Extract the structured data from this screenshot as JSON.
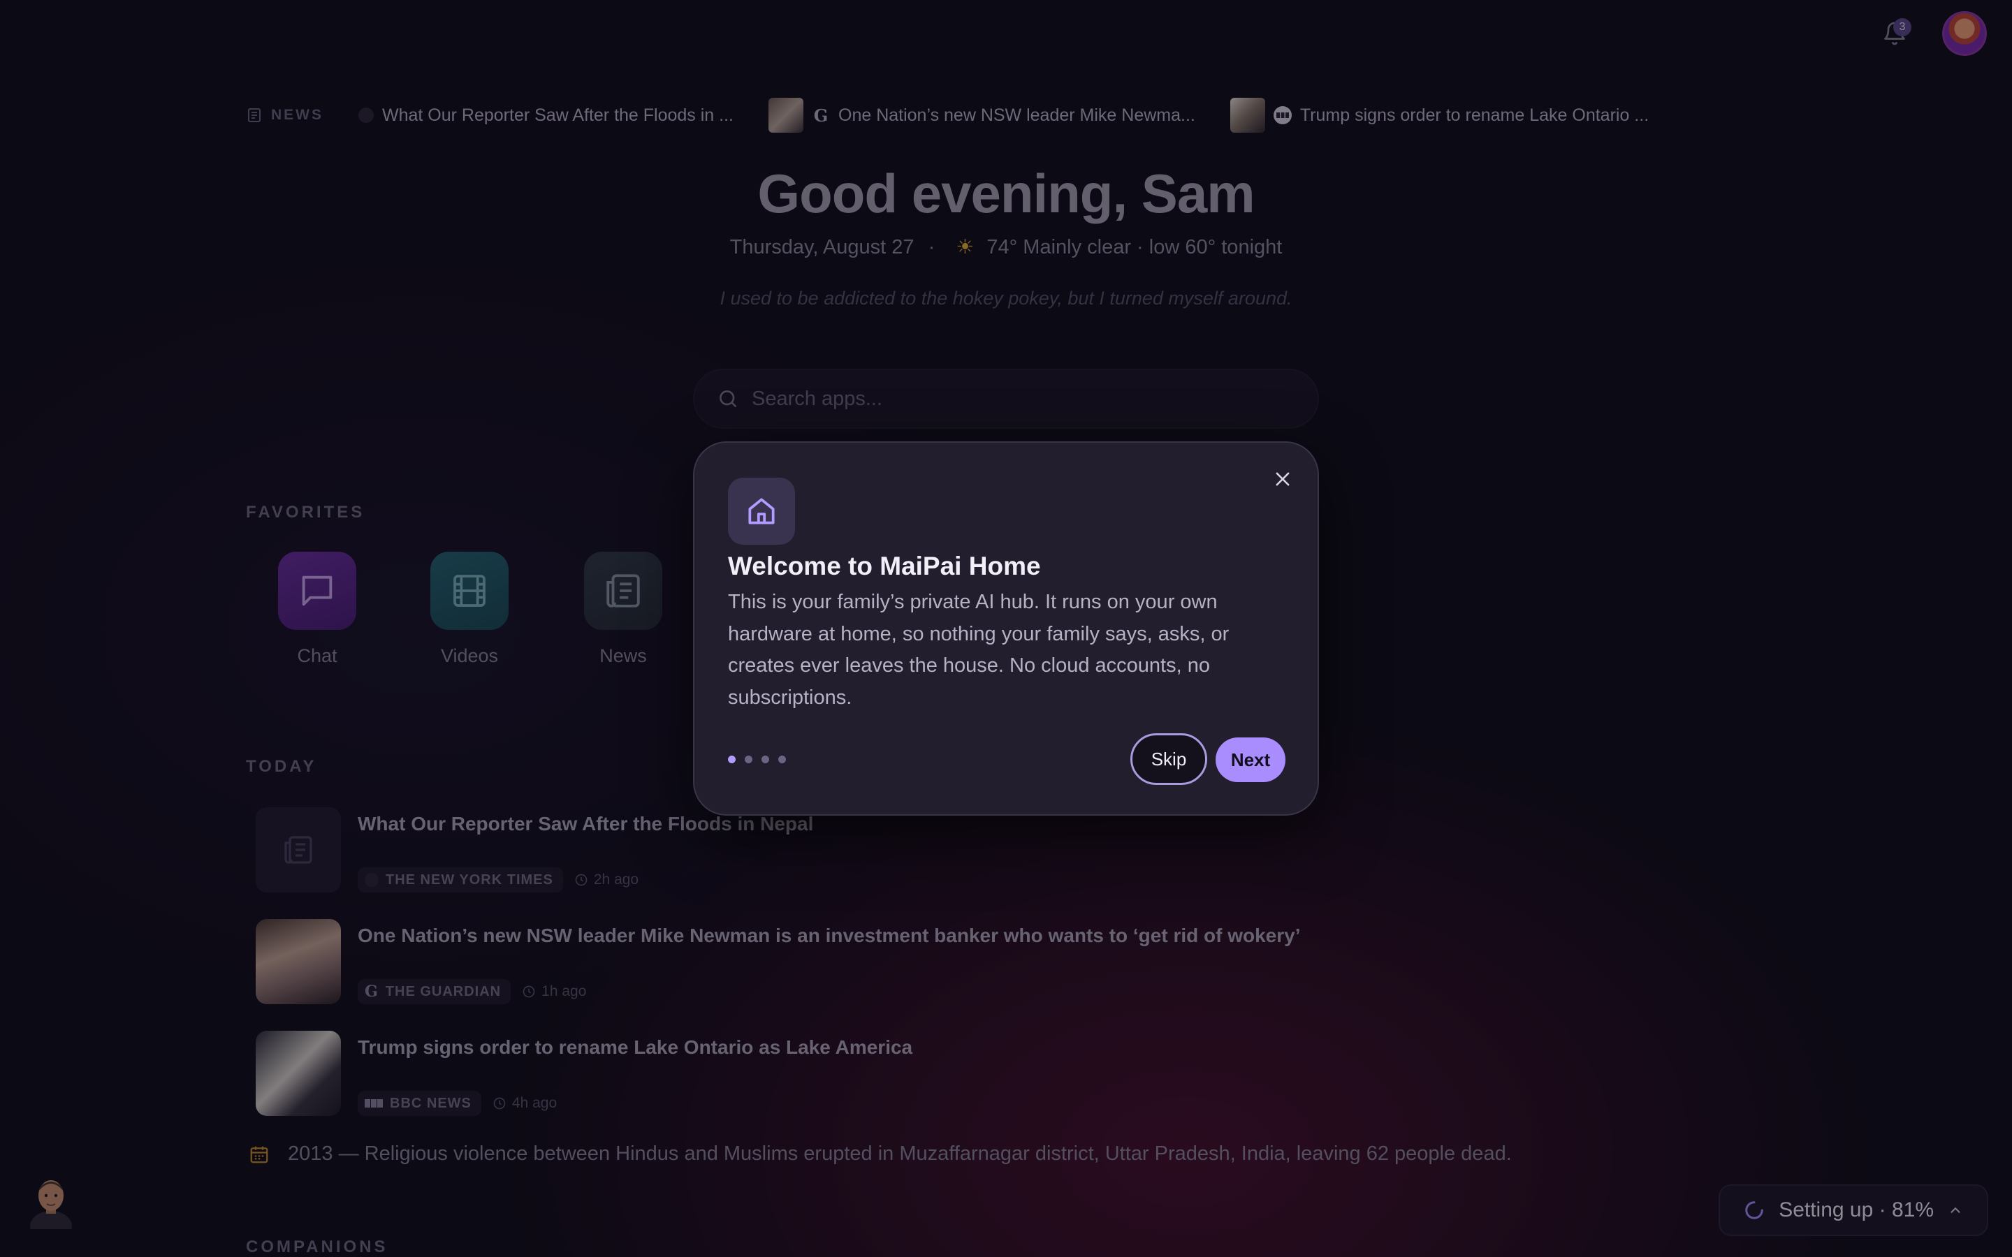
{
  "notifications": {
    "count": "3"
  },
  "news_ticker": {
    "label": "NEWS",
    "items": [
      {
        "title": "What Our Reporter Saw After the Floods in ..."
      },
      {
        "title": "One Nation’s new NSW leader Mike Newma...",
        "source_mark": "G"
      },
      {
        "title": "Trump signs order to rename Lake Ontario ..."
      }
    ]
  },
  "greeting": {
    "title": "Good evening, Sam",
    "date": "Thursday, August 27",
    "separator": "·",
    "weather": "74° Mainly clear · low 60° tonight",
    "quote": "I used to be addicted to the hokey pokey, but I turned myself around."
  },
  "search": {
    "placeholder": "Search apps..."
  },
  "favorites": {
    "title": "FAVORITES",
    "items": [
      {
        "label": "Chat",
        "color": "#5b2a86"
      },
      {
        "label": "Videos",
        "color": "#1f5563"
      },
      {
        "label": "News",
        "color": "#2b3440"
      }
    ]
  },
  "today": {
    "title": "TODAY",
    "items": [
      {
        "title": "What Our Reporter Saw After the Floods in Nepal",
        "source": "THE NEW YORK TIMES",
        "time": "2h ago"
      },
      {
        "title": "One Nation’s new NSW leader Mike Newman is an investment banker who wants to ‘get rid of wokery’",
        "source": "THE GUARDIAN",
        "source_mark": "G",
        "time": "1h ago"
      },
      {
        "title": "Trump signs order to rename Lake Ontario as Lake America",
        "source": "BBC NEWS",
        "time": "4h ago"
      }
    ]
  },
  "on_this_day": {
    "text": "2013 — Religious violence between Hindus and Muslims erupted in Muzaffarnagar district, Uttar Pradesh, India, leaving 62 people dead."
  },
  "companions": {
    "title": "COMPANIONS"
  },
  "setup_status": {
    "label": "Setting up · 81%",
    "progress_percent": 81
  },
  "modal": {
    "title": "Welcome to MaiPai Home",
    "body": "This is your family’s private AI hub. It runs on your own hardware at home, so nothing your family says, asks, or creates ever leaves the house. No cloud accounts, no subscriptions.",
    "step": 1,
    "total_steps": 4,
    "skip_label": "Skip",
    "next_label": "Next"
  },
  "colors": {
    "accent": "#a98dff",
    "background": "#120f1c",
    "modal": "#221e2d"
  }
}
